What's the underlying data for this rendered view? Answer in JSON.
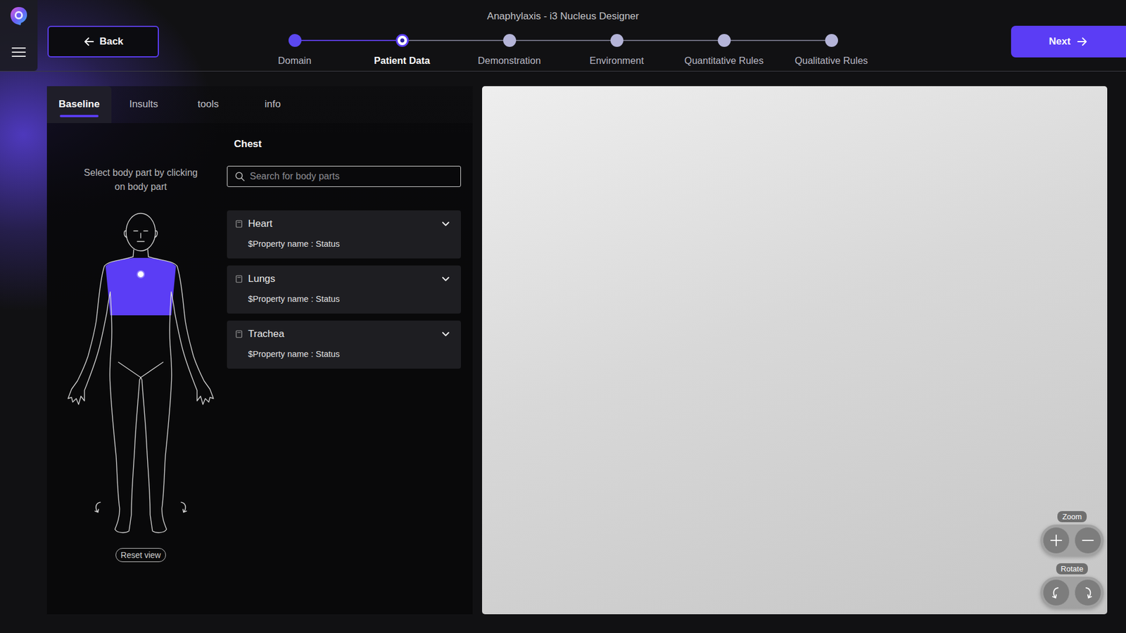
{
  "window": {
    "title": "Anaphylaxis - i3 Nucleus Designer"
  },
  "nav": {
    "back": "Back",
    "next": "Next"
  },
  "steps": [
    {
      "label": "Domain",
      "done": true,
      "selected": false
    },
    {
      "label": "Patient Data",
      "done": false,
      "selected": true
    },
    {
      "label": "Demonstration",
      "done": false,
      "selected": false
    },
    {
      "label": "Environment",
      "done": false,
      "selected": false
    },
    {
      "label": "Quantitative Rules",
      "done": false,
      "selected": false
    },
    {
      "label": "Qualitative Rules",
      "done": false,
      "selected": false
    }
  ],
  "tabs": [
    {
      "label": "Baseline",
      "selected": true
    },
    {
      "label": "Insults",
      "selected": false
    },
    {
      "label": "tools",
      "selected": false
    },
    {
      "label": "info",
      "selected": false
    }
  ],
  "body_map": {
    "hint": "Select body part by clicking on body part",
    "chest_selected": true,
    "reset": "Reset view"
  },
  "section": {
    "title": "Chest"
  },
  "search": {
    "placeholder": "Search for body parts"
  },
  "organs": [
    {
      "name": "Heart",
      "property": "$Property name : Status",
      "expanded": false
    },
    {
      "name": "Lungs",
      "property": "$Property name : Status",
      "expanded": false
    },
    {
      "name": "Trachea",
      "property": "$Property name : Status",
      "expanded": false
    }
  ],
  "viewport": {
    "zoom_label": "Zoom",
    "rotate_label": "Rotate"
  }
}
